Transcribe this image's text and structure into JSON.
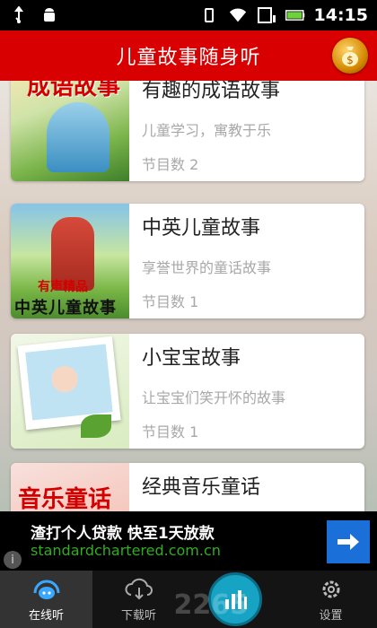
{
  "status_bar": {
    "time": "14:15"
  },
  "app_bar": {
    "title": "儿童故事随身听"
  },
  "stories": [
    {
      "title": "有趣的成语故事",
      "desc": "儿童学习，寓教于乐",
      "count": "节目数 2",
      "thumb_text": "成语故事"
    },
    {
      "title": "中英儿童故事",
      "desc": "享誉世界的童话故事",
      "count": "节目数 1",
      "thumb_text_1": "有声精品",
      "thumb_text_2": "中英儿童故事"
    },
    {
      "title": "小宝宝故事",
      "desc": "让宝宝们笑开怀的故事",
      "count": "节目数 1"
    },
    {
      "title": "经典音乐童话",
      "desc": "",
      "count": "",
      "thumb_text": "音乐童话"
    }
  ],
  "ad": {
    "line1": "渣打个人贷款 快至1天放款",
    "line2": "standardchartered.com.cn",
    "info": "i"
  },
  "nav": [
    {
      "label": "在线听"
    },
    {
      "label": "下载听"
    },
    {
      "label": "设置"
    }
  ],
  "watermark": "2265",
  "colors": {
    "appbar": "#d80000",
    "nav_active": "#333333",
    "player": "#16a3c4",
    "ad_arrow": "#1a6fd8"
  }
}
